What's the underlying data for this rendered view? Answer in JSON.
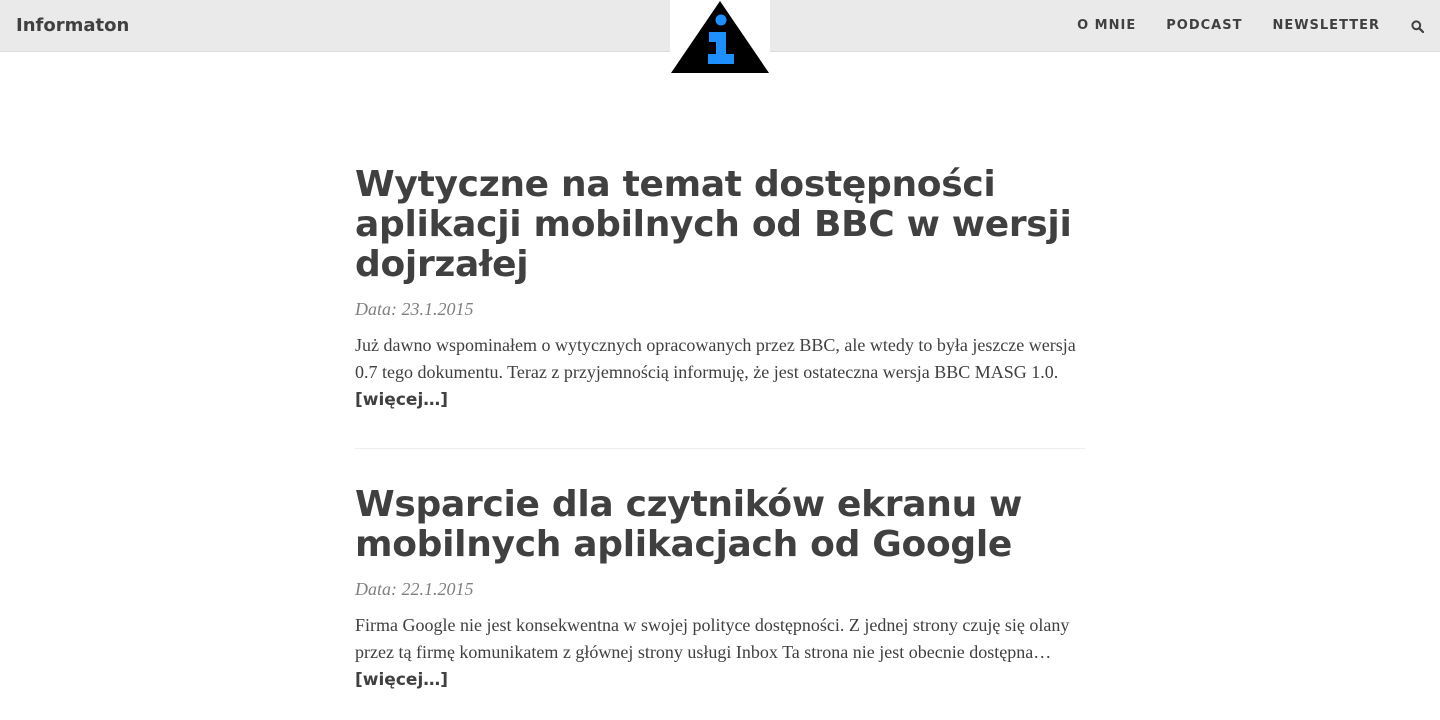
{
  "header": {
    "brand": "Informaton",
    "logo_icon": "info-triangle-icon",
    "logo_colors": {
      "triangle": "#000000",
      "symbol": "#1e8fff"
    },
    "nav": [
      {
        "label": "O MNIE"
      },
      {
        "label": "PODCAST"
      },
      {
        "label": "NEWSLETTER"
      }
    ],
    "search_icon": "search-icon"
  },
  "posts": [
    {
      "title": "Wytyczne na temat dostępności aplikacji mobilnych od BBC w wersji dojrzałej",
      "meta": "Data: 23.1.2015",
      "excerpt": "Już dawno wspominałem o wytycznych opracowanych przez BBC, ale wtedy to była jeszcze wersja 0.7 tego dokumentu. Teraz z przyjemnością informuję, że jest ostateczna wersja BBC MASG 1.0.",
      "more": "[więcej…]"
    },
    {
      "title": "Wsparcie dla czytników ekranu w mobilnych aplikacjach od Google",
      "meta": "Data: 22.1.2015",
      "excerpt": "Firma Google nie jest konsekwentna w swojej polityce dostępności. Z jednej strony czuję się olany przez tą firmę komunikatem z głównej strony usługi Inbox Ta strona nie jest obecnie dostępna…",
      "more": "[więcej…]"
    }
  ]
}
